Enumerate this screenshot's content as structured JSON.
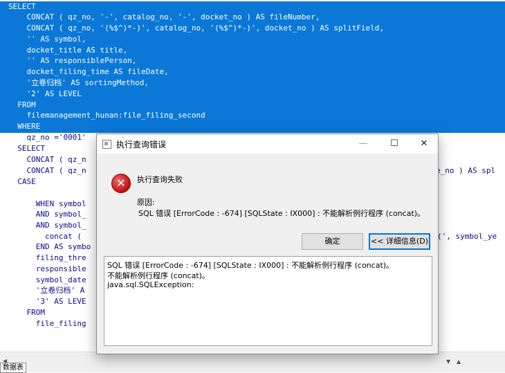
{
  "editor": {
    "lines": [
      "SELECT",
      "    CONCAT ( qz_no, '-', catalog_no, '-', docket_no ) AS fileNumber,",
      "    CONCAT ( qz_no, '(%$^)*-)', catalog_no, '(%$^)*-)', docket_no ) AS splitField,",
      "    '' AS symbol,",
      "    docket_title AS title,",
      "    '' AS responsiblePerson,",
      "    docket_filing_time AS fileDate,",
      "    '立卷归档' AS sortingMethod,",
      "    '2' AS LEVEL",
      "  FROM",
      "    filemanagement_hunan:file_filing_second",
      "  WHERE",
      "    qz_no ='0001'",
      "  SELECT",
      "    CONCAT ( qz_n",
      "    CONCAT ( qz_n",
      "  CASE",
      "",
      "      WHEN symbol",
      "      AND symbol_",
      "      AND symbol_",
      "        concat (",
      "      END AS symbo",
      "      filing_thre",
      "      responsible",
      "      symbol_date",
      "      '立卷归档' A",
      "      '3' AS LEVE",
      "    FROM",
      "      file_filing"
    ],
    "right_fragments": [
      "e_no ) AS spl",
      "(', symbol_ye"
    ],
    "bottom_tab": "数据表"
  },
  "dialog": {
    "title": "执行查询错误",
    "minimize": "—",
    "maximize": "☐",
    "close": "✕",
    "icon": "error-icon",
    "main_message": "执行查询失败",
    "reason_label": "原因:",
    "reason_text": "SQL 错误 [ErrorCode : -674]  [SQLState : IX000] : 不能解析例行程序 (concat)。",
    "ok_label": "确定",
    "details_label": "<< 详细信息(D)",
    "details_lines": [
      "SQL 错误 [ErrorCode : -674]  [SQLState : IX000] : 不能解析例行程序 (concat)。",
      "  不能解析例行程序 (concat)。",
      "    java.sql.SQLException:"
    ]
  }
}
